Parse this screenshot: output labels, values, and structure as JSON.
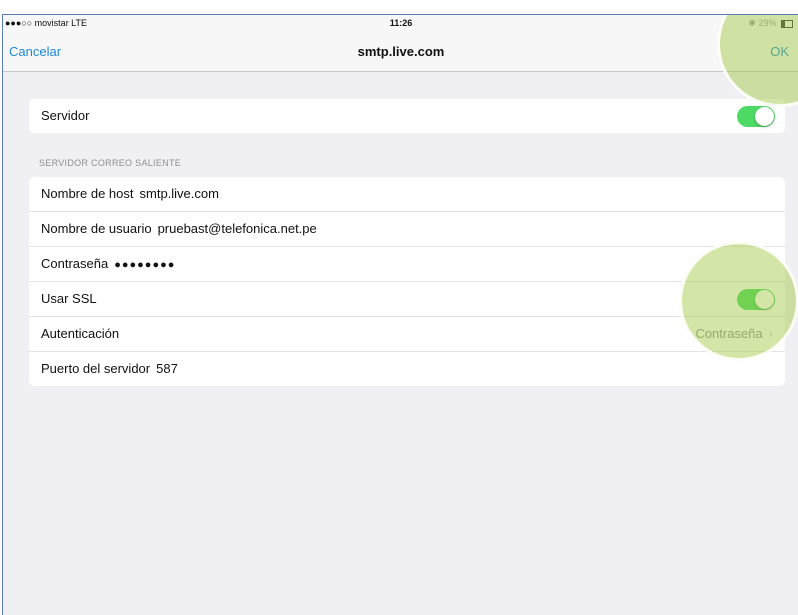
{
  "status": {
    "carrier": "●●●○○ movistar  LTE",
    "time": "11:26",
    "battery": "29%"
  },
  "nav": {
    "cancel": "Cancelar",
    "title": "smtp.live.com",
    "ok": "OK"
  },
  "server_row": {
    "label": "Servidor",
    "toggle_on": true
  },
  "section_header": "SERVIDOR CORREO SALIENTE",
  "fields": [
    {
      "label": "Nombre de host",
      "value": "smtp.live.com"
    },
    {
      "label": "Nombre de usuario",
      "value": "pruebast@telefonica.net.pe"
    },
    {
      "label": "Contraseña",
      "value": "●●●●●●●●"
    },
    {
      "label": "Usar SSL",
      "toggle_on": true
    },
    {
      "label": "Autenticación",
      "detail": "Contraseña",
      "chevron": "›"
    },
    {
      "label": "Puerto del servidor",
      "value": "587"
    }
  ],
  "colors": {
    "accent": "#1a8ad5",
    "toggle_on": "#4cd964",
    "highlight": "#a0c83c"
  }
}
